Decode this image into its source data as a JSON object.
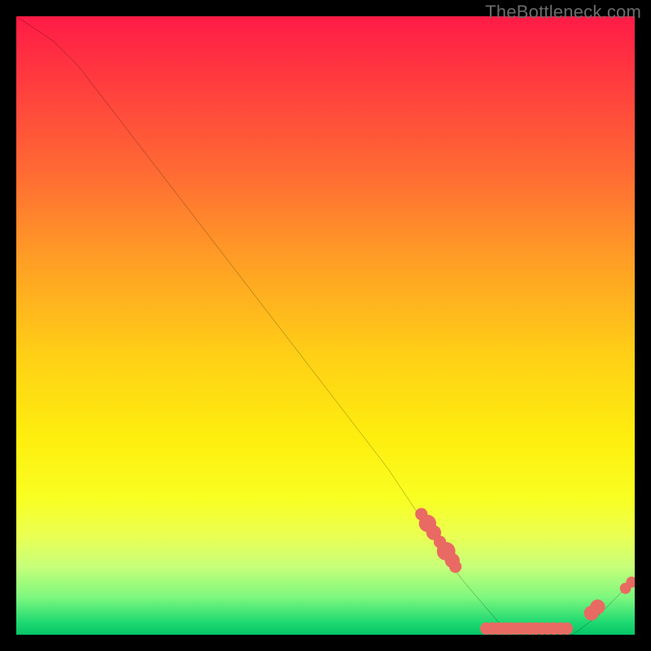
{
  "watermark": "TheBottleneck.com",
  "chart_data": {
    "type": "line",
    "title": "",
    "xlabel": "",
    "ylabel": "",
    "xlim": [
      0,
      100
    ],
    "ylim": [
      0,
      100
    ],
    "series": [
      {
        "name": "curve",
        "x": [
          0,
          6,
          10,
          20,
          30,
          40,
          50,
          60,
          66,
          72,
          78,
          84,
          90,
          94,
          100
        ],
        "y": [
          100,
          96,
          92,
          79,
          66,
          53,
          40,
          27,
          18,
          9,
          2,
          0,
          0,
          3,
          9
        ]
      }
    ],
    "scatter_points": {
      "name": "markers",
      "color": "#e96a62",
      "points": [
        {
          "x": 65.5,
          "y": 19.5,
          "r": 1.0
        },
        {
          "x": 66.5,
          "y": 18.0,
          "r": 1.4
        },
        {
          "x": 67.5,
          "y": 16.5,
          "r": 1.2
        },
        {
          "x": 68.5,
          "y": 15.0,
          "r": 1.0
        },
        {
          "x": 69.5,
          "y": 13.5,
          "r": 1.5
        },
        {
          "x": 70.5,
          "y": 12.0,
          "r": 1.2
        },
        {
          "x": 71.0,
          "y": 11.0,
          "r": 1.0
        },
        {
          "x": 76.0,
          "y": 1.0,
          "r": 1.0
        },
        {
          "x": 77.0,
          "y": 1.0,
          "r": 1.0
        },
        {
          "x": 78.0,
          "y": 1.0,
          "r": 1.0
        },
        {
          "x": 79.0,
          "y": 1.0,
          "r": 1.0
        },
        {
          "x": 80.0,
          "y": 1.0,
          "r": 1.0
        },
        {
          "x": 81.0,
          "y": 1.0,
          "r": 1.0
        },
        {
          "x": 82.0,
          "y": 1.0,
          "r": 1.0
        },
        {
          "x": 83.0,
          "y": 1.0,
          "r": 1.0
        },
        {
          "x": 84.0,
          "y": 1.0,
          "r": 1.0
        },
        {
          "x": 85.0,
          "y": 1.0,
          "r": 1.0
        },
        {
          "x": 86.0,
          "y": 1.0,
          "r": 1.0
        },
        {
          "x": 87.0,
          "y": 1.0,
          "r": 1.0
        },
        {
          "x": 88.0,
          "y": 1.0,
          "r": 1.0
        },
        {
          "x": 89.0,
          "y": 1.0,
          "r": 1.0
        },
        {
          "x": 93.0,
          "y": 3.5,
          "r": 1.2
        },
        {
          "x": 94.0,
          "y": 4.5,
          "r": 1.2
        },
        {
          "x": 98.5,
          "y": 7.5,
          "r": 0.9
        },
        {
          "x": 99.5,
          "y": 8.5,
          "r": 0.9
        }
      ]
    },
    "gradient_note": "red (top) through orange, yellow, light-green to green (bottom)"
  }
}
